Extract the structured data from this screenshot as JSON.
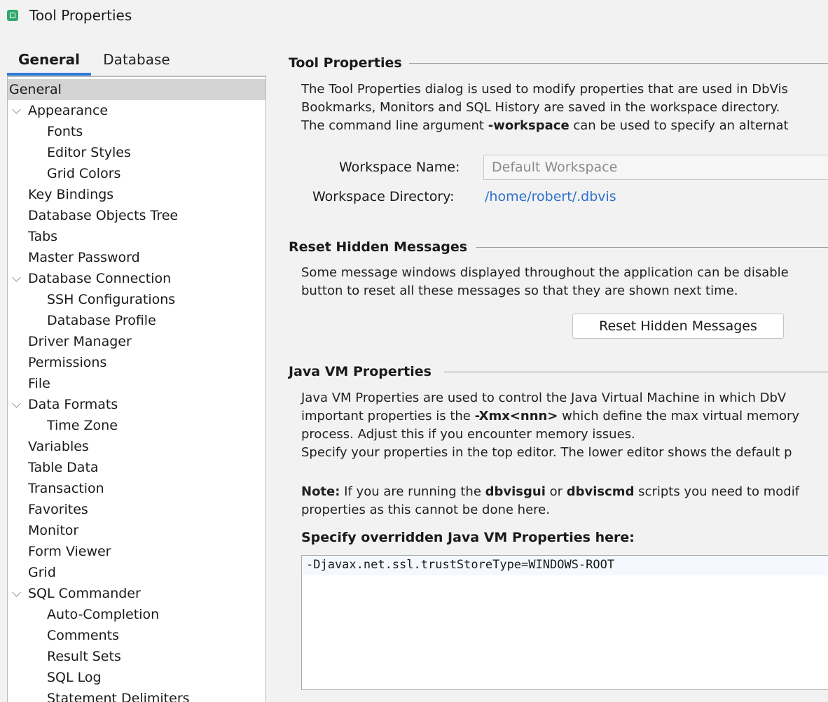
{
  "window": {
    "title": "Tool Properties"
  },
  "tabs": [
    {
      "label": "General",
      "selected": true
    },
    {
      "label": "Database",
      "selected": false
    }
  ],
  "tree": [
    {
      "label": "General",
      "selected": true
    },
    {
      "label": "Appearance",
      "expanded": true
    },
    {
      "label": "Fonts"
    },
    {
      "label": "Editor Styles"
    },
    {
      "label": "Grid Colors"
    },
    {
      "label": "Key Bindings"
    },
    {
      "label": "Database Objects Tree"
    },
    {
      "label": "Tabs"
    },
    {
      "label": "Master Password"
    },
    {
      "label": "Database Connection",
      "expanded": true
    },
    {
      "label": "SSH Configurations"
    },
    {
      "label": "Database Profile"
    },
    {
      "label": "Driver Manager"
    },
    {
      "label": "Permissions"
    },
    {
      "label": "File"
    },
    {
      "label": "Data Formats",
      "expanded": true
    },
    {
      "label": "Time Zone"
    },
    {
      "label": "Variables"
    },
    {
      "label": "Table Data"
    },
    {
      "label": "Transaction"
    },
    {
      "label": "Favorites"
    },
    {
      "label": "Monitor"
    },
    {
      "label": "Form Viewer"
    },
    {
      "label": "Grid"
    },
    {
      "label": "SQL Commander",
      "expanded": true
    },
    {
      "label": "Auto-Completion"
    },
    {
      "label": "Comments"
    },
    {
      "label": "Result Sets"
    },
    {
      "label": "SQL Log"
    },
    {
      "label": "Statement Delimiters"
    }
  ],
  "tool_properties": {
    "title": "Tool Properties",
    "line1": "The Tool Properties dialog is used to modify properties that are used in DbVis",
    "line2": "Bookmarks, Monitors and SQL History are saved in the workspace directory.",
    "line3_pre": "The command line argument ",
    "line3_bold": "-workspace",
    "line3_post": " can be used to specify an alternat",
    "workspace_name_label": "Workspace Name:",
    "workspace_name_value": "Default Workspace",
    "workspace_dir_label": "Workspace Directory:",
    "workspace_dir_value": "/home/robert/.dbvis"
  },
  "reset_hidden": {
    "title": "Reset Hidden Messages",
    "line1": "Some message windows displayed throughout the application can be disable",
    "line2": "button to reset all these messages so that they are shown next time.",
    "button_label": "Reset Hidden Messages"
  },
  "java_vm": {
    "title": "Java VM Properties",
    "line1": "Java VM Properties are used to control the Java Virtual Machine in which DbV",
    "line2_pre": "important properties is the ",
    "line2_bold": "-Xmx<nnn>",
    "line2_post": " which define the max virtual memory",
    "line3": "process. Adjust this if you encounter memory issues.",
    "line4": "Specify your properties in the top editor. The lower editor shows the default p",
    "note_label": "Note:",
    "note_pre": " If you are running the ",
    "note_bold1": "dbvisgui",
    "note_mid": " or ",
    "note_bold2": "dbviscmd",
    "note_post": " scripts you need to modif",
    "note_line2": "properties as this cannot be done here.",
    "editor_heading": "Specify overridden Java VM Properties here:",
    "editor_value": "-Djavax.net.ssl.trustStoreType=WINDOWS-ROOT"
  }
}
